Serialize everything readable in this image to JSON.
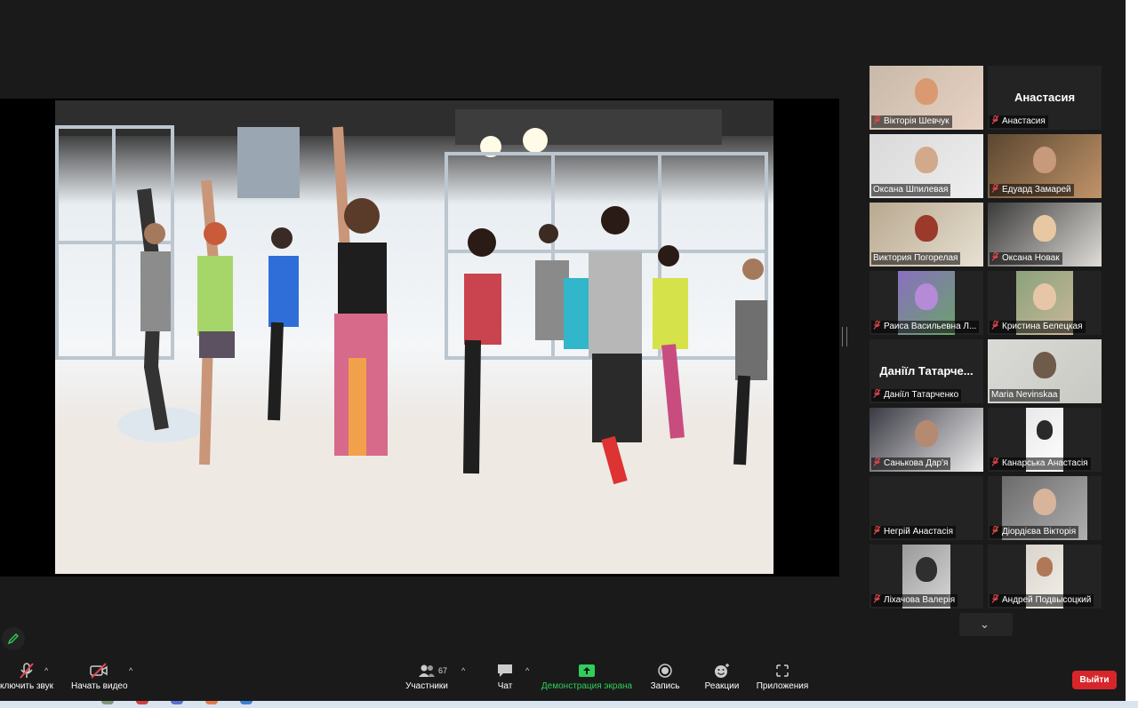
{
  "participants": [
    {
      "name": "Вікторія Шевчук",
      "muted": true,
      "video": true
    },
    {
      "name": "Анастасия",
      "display": "Анастасия",
      "muted": true,
      "video": false
    },
    {
      "name": "Оксана Шпилевая",
      "muted": false,
      "video": true
    },
    {
      "name": "Едуард Замарей",
      "muted": true,
      "video": true
    },
    {
      "name": "Виктория Погорелая",
      "muted": false,
      "video": true
    },
    {
      "name": "Оксана Новак",
      "muted": true,
      "video": true
    },
    {
      "name": "Раиса Васильевна Л...",
      "muted": true,
      "video": true
    },
    {
      "name": "Кристина Белецкая",
      "muted": true,
      "video": true
    },
    {
      "name": "Даніїл Татарченко",
      "display": "Даніїл Татарче...",
      "muted": true,
      "video": false
    },
    {
      "name": "Maria Nevinskaa",
      "muted": false,
      "video": true,
      "active": true
    },
    {
      "name": "Санькова Дар'я",
      "muted": true,
      "video": true
    },
    {
      "name": "Канарська Анастасія",
      "muted": true,
      "video": true
    },
    {
      "name": "Негрій Анастасія",
      "muted": true,
      "video": false
    },
    {
      "name": "Діордієва Вікторія",
      "muted": true,
      "video": true
    },
    {
      "name": "Ліхачова Валерія",
      "muted": true,
      "video": true
    },
    {
      "name": "Андрей Подвысоцкий",
      "muted": true,
      "video": true
    }
  ],
  "toolbar": {
    "audio_label": "ключить звук",
    "video_label": "Начать видео",
    "participants_label": "Участники",
    "participants_count": "67",
    "chat_label": "Чат",
    "share_label": "Демонстрация экрана",
    "record_label": "Запись",
    "reactions_label": "Реакции",
    "apps_label": "Приложения",
    "leave_label": "Выйти"
  },
  "colors": {
    "accent_green": "#2fcf5a",
    "leave_red": "#d7262b",
    "active_speaker": "#dfe57a",
    "muted_red": "#e0474c"
  }
}
